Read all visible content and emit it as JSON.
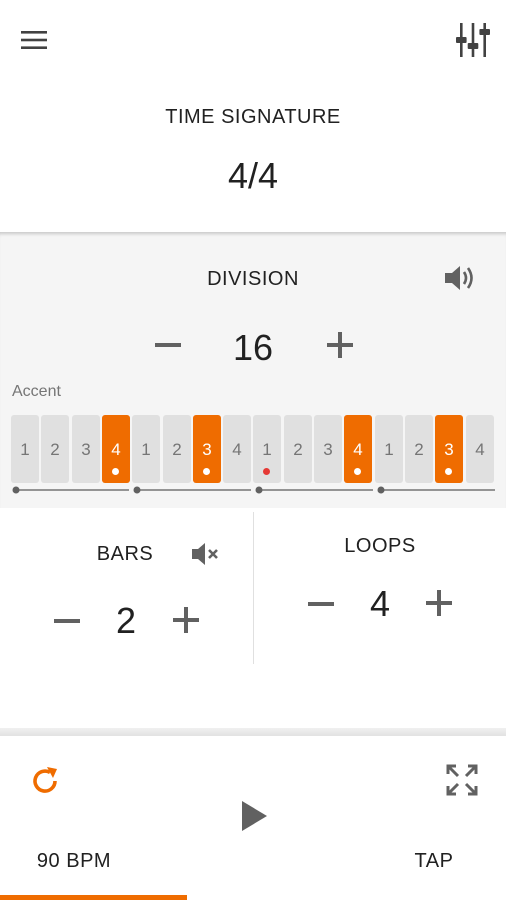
{
  "header": {
    "menu_icon": "hamburger-menu-icon",
    "mixer_icon": "equalizer-sliders-icon"
  },
  "time_signature": {
    "title": "TIME SIGNATURE",
    "value": "4/4"
  },
  "division": {
    "title": "DIVISION",
    "value": "16",
    "minus_label": "−",
    "plus_label": "+",
    "sound_icon": "volume-up-icon",
    "accent_label": "Accent",
    "accent_color": "#ef6c00",
    "cells": [
      {
        "label": "1",
        "active": false
      },
      {
        "label": "2",
        "active": false
      },
      {
        "label": "3",
        "active": false
      },
      {
        "label": "4",
        "active": true
      },
      {
        "label": "1",
        "active": false
      },
      {
        "label": "2",
        "active": false
      },
      {
        "label": "3",
        "active": true
      },
      {
        "label": "4",
        "active": false
      },
      {
        "label": "1",
        "active": false,
        "red_dot": true
      },
      {
        "label": "2",
        "active": false
      },
      {
        "label": "3",
        "active": false
      },
      {
        "label": "4",
        "active": true
      },
      {
        "label": "1",
        "active": false
      },
      {
        "label": "2",
        "active": false
      },
      {
        "label": "3",
        "active": true
      },
      {
        "label": "4",
        "active": false
      }
    ]
  },
  "bars": {
    "title": "BARS",
    "value": "2",
    "minus_label": "−",
    "plus_label": "+",
    "mute_icon": "volume-off-icon"
  },
  "loops": {
    "title": "LOOPS",
    "value": "4",
    "minus_label": "−",
    "plus_label": "+"
  },
  "footer": {
    "repeat_icon": "repeat-icon",
    "fullscreen_icon": "fullscreen-icon",
    "play_icon": "play-icon",
    "bpm_label": "90 BPM",
    "tap_label": "TAP",
    "progress": 0.37
  }
}
